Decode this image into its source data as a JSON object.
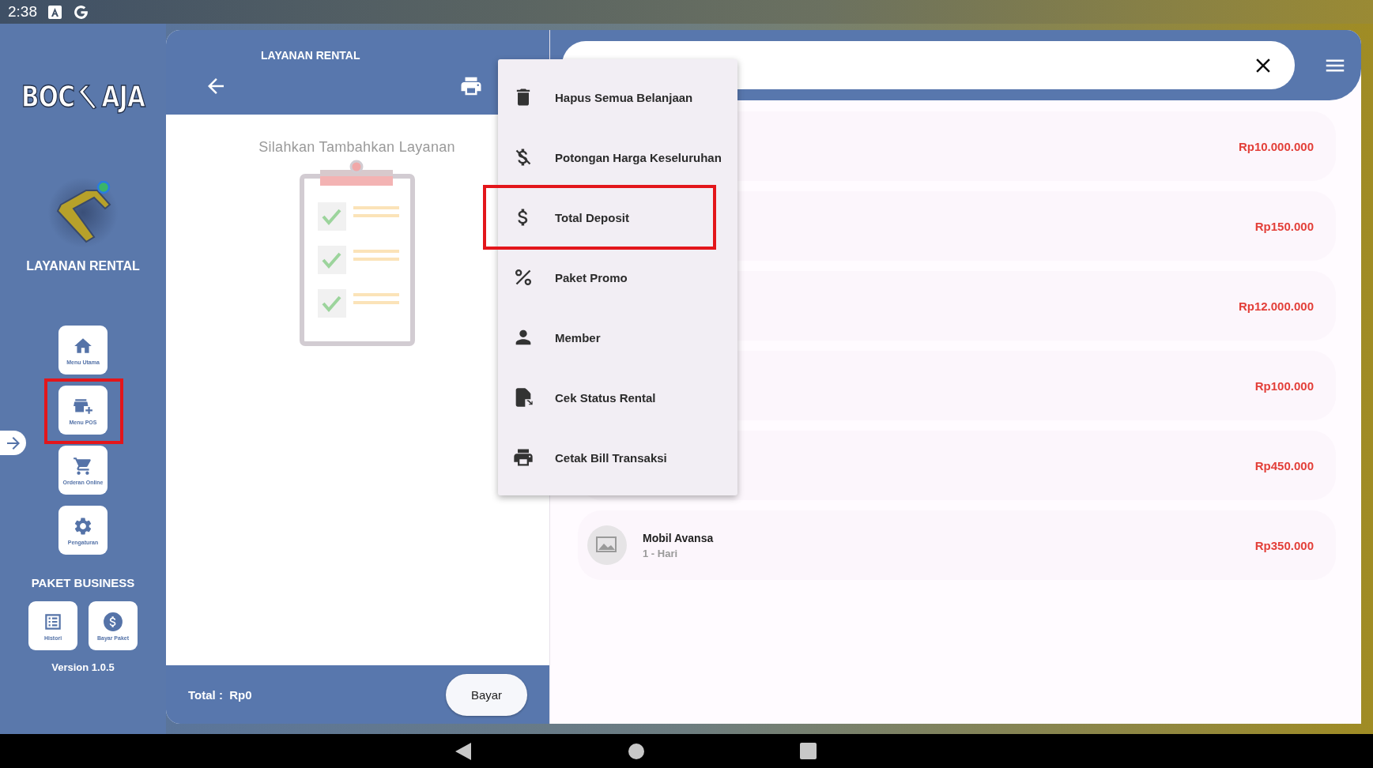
{
  "status_bar": {
    "time": "2:38"
  },
  "sidebar": {
    "logo_left": "BOC",
    "logo_right": "AJA",
    "title": "LAYANAN RENTAL",
    "nav": [
      {
        "label": "Menu Utama",
        "highlighted": false
      },
      {
        "label": "Menu POS",
        "highlighted": true
      },
      {
        "label": "Orderan Online",
        "highlighted": false
      },
      {
        "label": "Pengaturan",
        "highlighted": false
      }
    ],
    "section_title": "PAKET BUSINESS",
    "package_buttons": [
      {
        "label": "Histori"
      },
      {
        "label": "Bayar Paket"
      }
    ],
    "version": "Version 1.0.5"
  },
  "panel": {
    "title": "LAYANAN RENTAL",
    "empty_message": "Silahkan Tambahkan Layanan",
    "total_label": "Total :",
    "total_value": "Rp0",
    "pay_button": "Bayar"
  },
  "products": [
    {
      "price": "Rp10.000.000"
    },
    {
      "price": "Rp150.000"
    },
    {
      "price": "Rp12.000.000"
    },
    {
      "price": "Rp100.000"
    },
    {
      "price": "Rp450.000"
    },
    {
      "name": "Mobil Avansa",
      "duration": "1 - Hari",
      "price": "Rp350.000"
    }
  ],
  "menu": [
    {
      "label": "Hapus Semua Belanjaan",
      "highlighted": false
    },
    {
      "label": "Potongan Harga Keseluruhan",
      "highlighted": false
    },
    {
      "label": "Total Deposit",
      "highlighted": true
    },
    {
      "label": "Paket Promo",
      "highlighted": false
    },
    {
      "label": "Member",
      "highlighted": false
    },
    {
      "label": "Cek Status Rental",
      "highlighted": false
    },
    {
      "label": "Cetak Bill Transaksi",
      "highlighted": false
    }
  ]
}
